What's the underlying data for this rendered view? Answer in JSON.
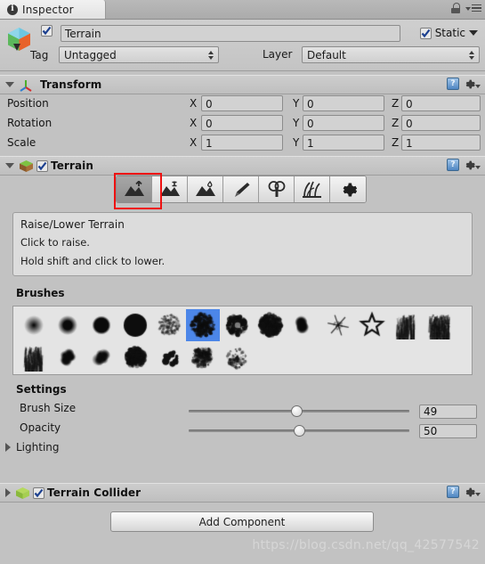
{
  "window": {
    "tab_label": "Inspector",
    "tab_icon": "info-icon",
    "lock_icon": "lock-icon",
    "menu_icon": "hamburger-menu-icon"
  },
  "object_header": {
    "icon": "gameobject-cube-icon",
    "enabled": true,
    "name": "Terrain",
    "static_label": "Static",
    "static_checked": true,
    "tag_label": "Tag",
    "tag_value": "Untagged",
    "layer_label": "Layer",
    "layer_value": "Default"
  },
  "components": [
    {
      "title": "Transform",
      "icon": "transform-gizmo-icon",
      "expanded": true,
      "help_icon": "help-book-icon",
      "gear_icon": "gear-icon",
      "rows": [
        {
          "label": "Position",
          "axes": [
            "X",
            "Y",
            "Z"
          ],
          "values": [
            "0",
            "0",
            "0"
          ]
        },
        {
          "label": "Rotation",
          "axes": [
            "X",
            "Y",
            "Z"
          ],
          "values": [
            "0",
            "0",
            "0"
          ]
        },
        {
          "label": "Scale",
          "axes": [
            "X",
            "Y",
            "Z"
          ],
          "values": [
            "1",
            "1",
            "1"
          ]
        }
      ]
    },
    {
      "title": "Terrain",
      "icon": "terrain-block-icon",
      "expanded": true,
      "enabled": true,
      "help_icon": "help-book-icon",
      "gear_icon": "gear-icon"
    },
    {
      "title": "Terrain Collider",
      "icon": "terrain-block-icon",
      "expanded": false,
      "enabled": true,
      "help_icon": "help-book-icon",
      "gear_icon": "gear-icon"
    }
  ],
  "terrain": {
    "toolbar": {
      "selected_index": 0,
      "highlight_color": "#ee1111",
      "tools": [
        {
          "name": "raise-lower-terrain-tool",
          "icon": "mountain-up-arrow-icon"
        },
        {
          "name": "paint-height-tool",
          "icon": "mountain-plus-icon"
        },
        {
          "name": "smooth-height-tool",
          "icon": "mountain-droplet-icon"
        },
        {
          "name": "paint-texture-tool",
          "icon": "paintbrush-icon"
        },
        {
          "name": "place-trees-tool",
          "icon": "tree-icon"
        },
        {
          "name": "paint-details-tool",
          "icon": "grass-icon"
        },
        {
          "name": "terrain-settings-tool",
          "icon": "gear-icon"
        }
      ]
    },
    "help": {
      "title": "Raise/Lower Terrain",
      "line1": "Click to raise.",
      "line2": "Hold shift and click to lower."
    },
    "brushes_title": "Brushes",
    "brushes": {
      "selected_index": 5,
      "selected_color": "#4c86e8",
      "row1_count": 13,
      "row2_count": 7
    },
    "settings_title": "Settings",
    "settings": [
      {
        "label": "Brush Size",
        "value": "49",
        "percent": 49
      },
      {
        "label": "Opacity",
        "value": "50",
        "percent": 50
      }
    ],
    "lighting_label": "Lighting",
    "lighting_expanded": false
  },
  "footer": {
    "add_component_label": "Add Component",
    "watermark": "https://blog.csdn.net/qq_42577542"
  }
}
